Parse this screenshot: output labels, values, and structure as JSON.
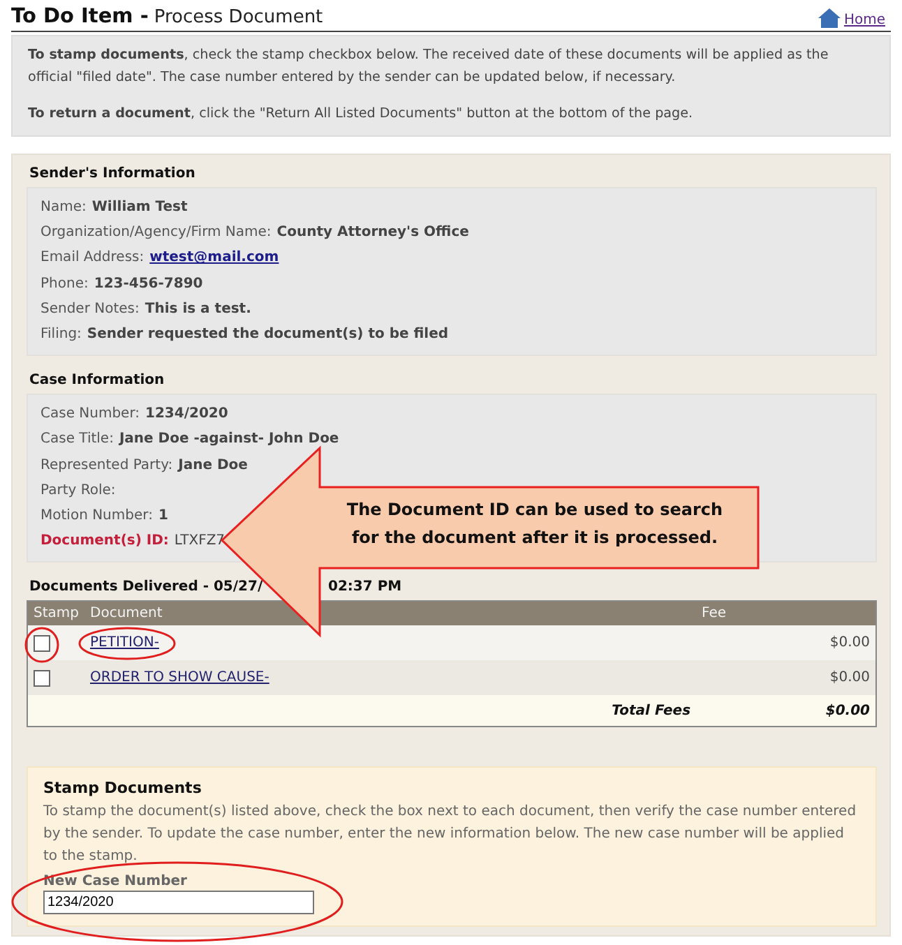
{
  "header": {
    "title": "To Do Item -",
    "subtitle": "Process Document",
    "home_link": "Home"
  },
  "instructions": [
    "**To stamp documents**, check the stamp checkbox below. The received date of these documents will be applied as the official \"filed date\". The case number entered by the sender can be updated below, if necessary.",
    "**To return a document**, click the \"Return All Listed Documents\" button at the bottom of the page."
  ],
  "sender": {
    "heading": "Sender's Information",
    "fields": [
      {
        "label": "Name:",
        "value": "William Test",
        "kind": "text"
      },
      {
        "label": "Organization/Agency/Firm Name:",
        "value": "County Attorney's Office",
        "kind": "text"
      },
      {
        "label": "Email Address:",
        "value": " wtest@mail.com",
        "kind": "link"
      },
      {
        "label": "Phone:",
        "value": "123-456-7890",
        "kind": "text"
      },
      {
        "label": "Sender Notes:",
        "value": "This is a test.",
        "kind": "text"
      },
      {
        "label": "Filing:",
        "value": "Sender requested the document(s) to be filed",
        "kind": "text"
      }
    ]
  },
  "case": {
    "heading": "Case Information",
    "fields": [
      {
        "label": "Case Number:",
        "value": "1234/2020",
        "kind": "text"
      },
      {
        "label": "Case Title:",
        "value": "Jane Doe -against- John Doe",
        "kind": "text"
      },
      {
        "label": "Represented Party:",
        "value": "Jane Doe",
        "kind": "text"
      },
      {
        "label": "Party Role:",
        "kind": "text"
      },
      {
        "label": "Motion Number:",
        "value": "1",
        "kind": "text"
      },
      {
        "label": "Document(s) ID:",
        "value": "LTXFZ7",
        "kind": "id"
      }
    ]
  },
  "documents": {
    "heading_start": "Documents Delivered - 05/27/",
    "heading_end": "02:37 PM",
    "columns": [
      "Stamp",
      "Document",
      "Fee"
    ],
    "rows": [
      {
        "document": "PETITION-",
        "fee": "$0.00",
        "checked": false,
        "highlighted": true
      },
      {
        "document": "ORDER TO SHOW CAUSE-",
        "fee": "$0.00",
        "checked": false,
        "highlighted": false
      }
    ],
    "total_label": "Total Fees",
    "total": "$0.00"
  },
  "stamp": {
    "heading": "Stamp Documents",
    "text": "To stamp the document(s) listed above, check the box next to each document, then verify the case number entered by the sender. To update the case number, enter the new information below. The new case number will be applied to the stamp.",
    "field_label": "New Case Number",
    "field_value": "1234/2020",
    "highlighted": true
  },
  "callout": {
    "text": "The Document ID can be used to search for the document after it is processed."
  }
}
